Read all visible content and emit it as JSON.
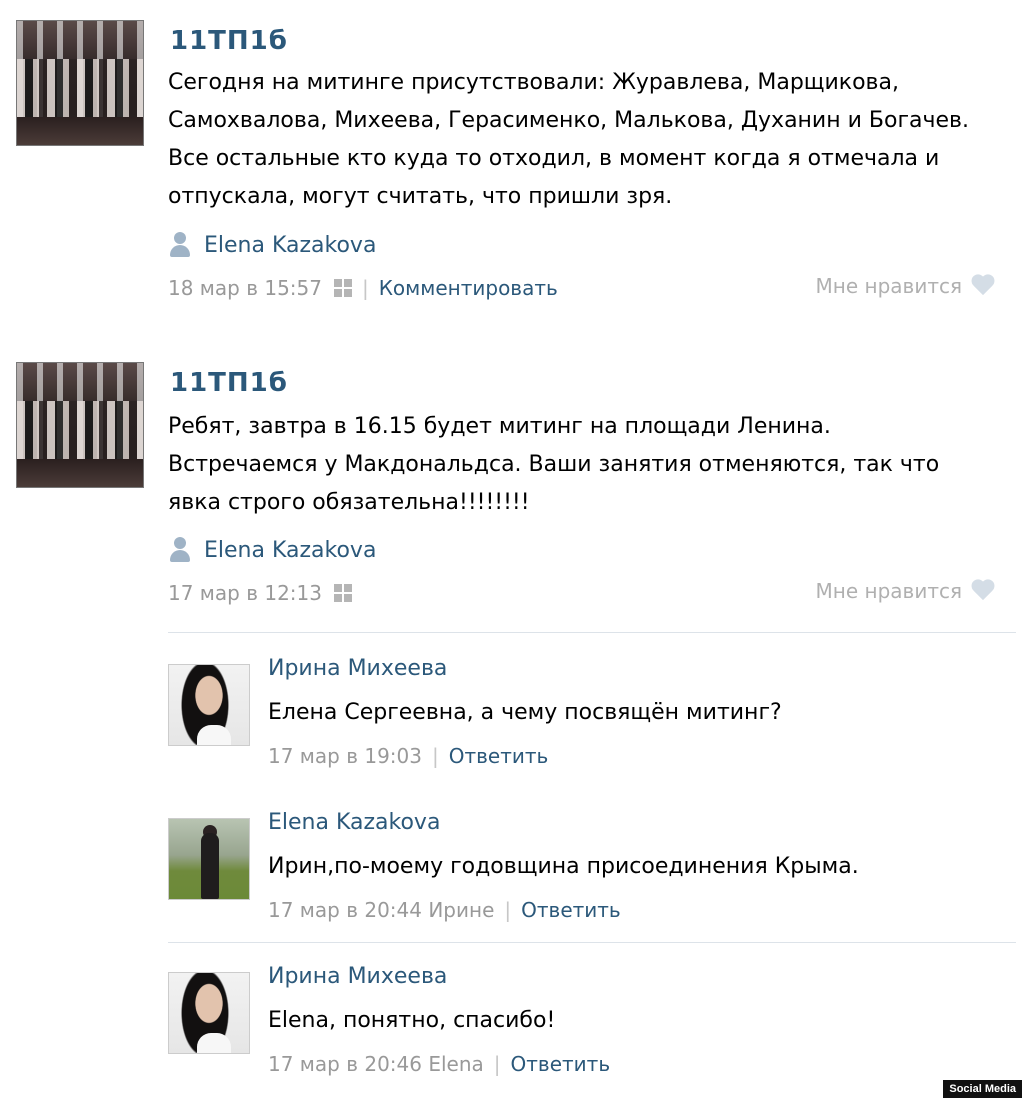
{
  "posts": [
    {
      "group": "11ТП1б",
      "text": "Сегодня на митинге присутствовали: Журавлева, Марщикова, Самохвалова, Михеева, Герасименко, Малькова, Духанин и Богачев. Все остальные кто куда то отходил, в момент когда я отмечала и отпускала, могут считать, что пришли зря.",
      "author": "Elena Kazakova",
      "time": "18 мар в 15:57",
      "comment_label": "Комментировать",
      "like_label": "Мне нравится"
    },
    {
      "group": "11ТП1б",
      "text": "Ребят, завтра в 16.15 будет митинг на площади Ленина. Встречаемся у Макдональдса. Ваши занятия отменяются, так что явка строго обязательна!!!!!!!!",
      "author": "Elena Kazakova",
      "time": "17 мар в 12:13",
      "like_label": "Мне нравится"
    }
  ],
  "replies": [
    {
      "name": "Ирина Михеева",
      "text": "Елена Сергеевна, а чему посвящён митинг?",
      "time": "17 мар в 19:03",
      "reply_label": "Ответить"
    },
    {
      "name": "Elena Kazakova",
      "text": "Ирин,по-моему годовщина присоединения Крыма.",
      "time": "17 мар в 20:44 Ирине",
      "reply_label": "Ответить"
    },
    {
      "name": "Ирина Михеева",
      "text": "Elena, понятно, спасибо!",
      "time": "17 мар в 20:46 Elena",
      "reply_label": "Ответить"
    }
  ],
  "watermark": "Social Media",
  "colors": {
    "link": "#2b587a",
    "meta": "#999999",
    "divider": "#dde3e9"
  }
}
